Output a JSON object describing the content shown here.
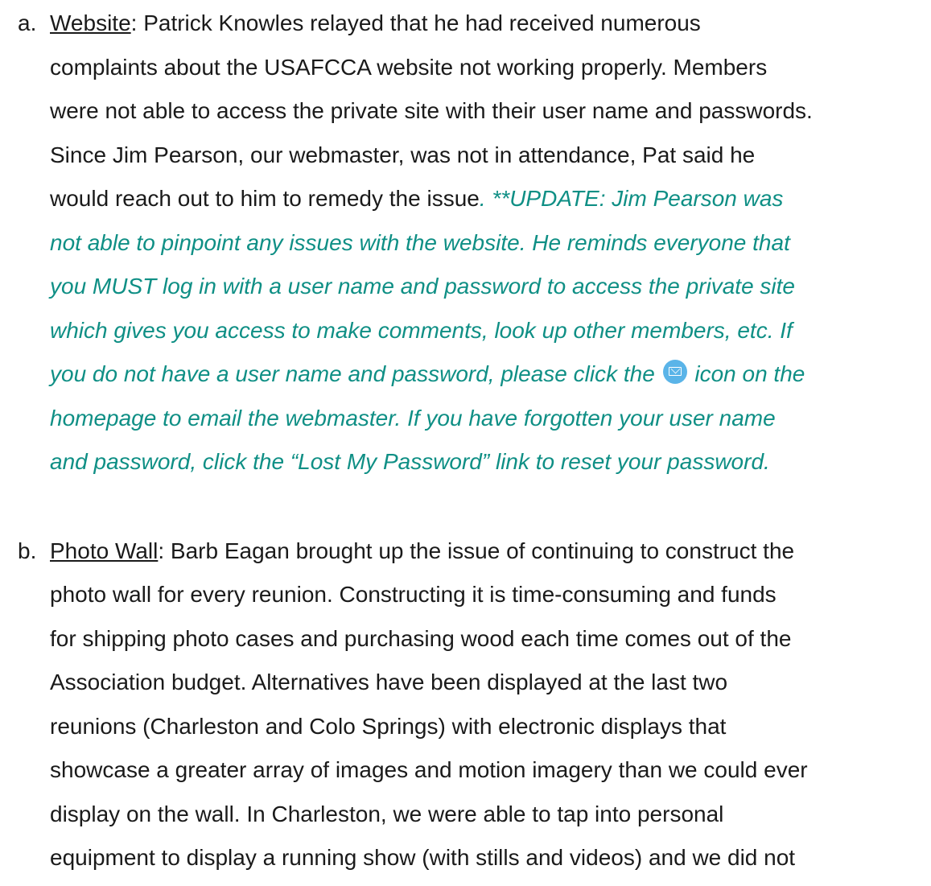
{
  "items": [
    {
      "marker": "a.",
      "heading": "Website",
      "lines": [
        ": Patrick Knowles relayed that he had received numerous",
        "complaints about the USAFCCA website not working properly.  Members",
        "were not able to access the private site with their user name and passwords.",
        "Since Jim Pearson, our webmaster, was not in attendance, Pat said he",
        "would reach out to him to remedy the issue"
      ],
      "update_lines": [
        ". **UPDATE: Jim Pearson was",
        "not able to pinpoint any issues with the website.  He reminds everyone that",
        "you MUST log in with a user name and password to access the private site",
        "which gives you access to make comments, look up other members, etc.  If",
        "you do not have a user name and password, please click the",
        " icon on the",
        "homepage to email the webmaster.  If you have forgotten your user name",
        "and password, click the “Lost My Password” link to reset your password."
      ]
    },
    {
      "marker": "b.",
      "heading": "Photo Wall",
      "lines": [
        ": Barb Eagan brought up the issue of continuing to construct the",
        "photo wall for every reunion.  Constructing it is time-consuming and funds",
        "for shipping photo cases and purchasing wood each time comes out of the",
        "Association budget.  Alternatives have been displayed at the last two",
        "reunions (Charleston and Colo Springs) with electronic displays that",
        "showcase a greater array of images and motion imagery than we could ever",
        "display on the wall. In Charleston, we were able to tap into personal",
        "equipment to display a running show (with stills and videos) and we did not"
      ]
    }
  ],
  "icons": {
    "mail": "email-icon",
    "mail_color": "#5ab4e8"
  },
  "colors": {
    "text": "#1a1a1a",
    "update": "#0f8f85"
  }
}
